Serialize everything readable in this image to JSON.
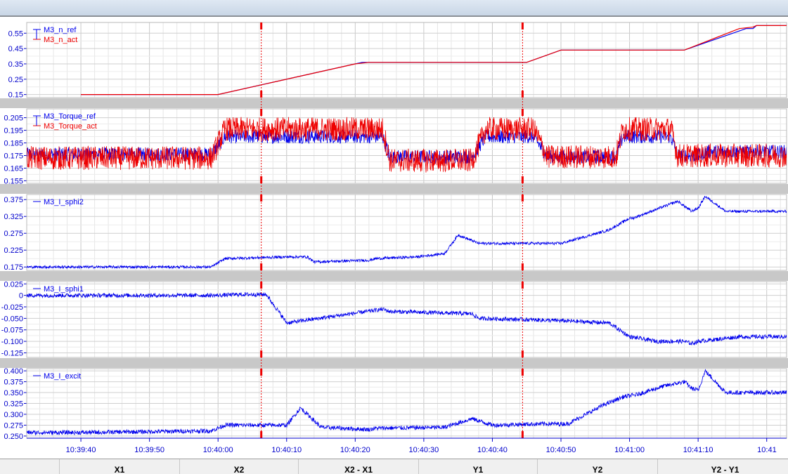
{
  "chart_data": [
    {
      "type": "line",
      "ylim": [
        0.13,
        0.62
      ],
      "yticks": [
        "0.55",
        "0.45",
        "0.35",
        "0.25",
        "0.15"
      ],
      "ytick_values": [
        0.55,
        0.45,
        0.35,
        0.25,
        0.15
      ],
      "series": [
        {
          "name": "M3_n_ref",
          "color": "#0000ee",
          "x": [
            -20,
            0,
            21,
            35,
            45,
            50,
            62,
            68,
            77,
            78,
            78.5,
            130
          ],
          "y": [
            0.15,
            0.15,
            0.36,
            0.36,
            0.36,
            0.44,
            0.44,
            0.44,
            0.58,
            0.58,
            0.6,
            0.6
          ]
        },
        {
          "name": "M3_n_act",
          "color": "#ee0000",
          "x": [
            -20,
            0,
            20,
            22,
            35,
            45,
            50,
            62,
            68,
            76,
            78,
            78.5,
            130
          ],
          "y": [
            0.15,
            0.15,
            0.35,
            0.36,
            0.36,
            0.36,
            0.44,
            0.44,
            0.44,
            0.58,
            0.59,
            0.6,
            0.6
          ]
        }
      ],
      "noise": [
        0,
        0
      ]
    },
    {
      "type": "line",
      "ylim": [
        0.153,
        0.212
      ],
      "yticks": [
        "0.205",
        "0.195",
        "0.185",
        "0.175",
        "0.165",
        "0.155"
      ],
      "ytick_values": [
        0.205,
        0.195,
        0.185,
        0.175,
        0.165,
        0.155
      ],
      "series": [
        {
          "name": "M3_Torque_ref",
          "color": "#0000ee",
          "x": [
            -20,
            -1,
            1,
            9,
            10,
            24,
            25,
            32,
            33,
            37,
            39,
            46,
            48,
            58,
            59,
            66,
            67,
            70,
            71,
            130
          ],
          "y": [
            0.176,
            0.176,
            0.19,
            0.19,
            0.19,
            0.19,
            0.174,
            0.174,
            0.174,
            0.174,
            0.19,
            0.19,
            0.174,
            0.174,
            0.19,
            0.19,
            0.175,
            0.175,
            0.178,
            0.178
          ]
        },
        {
          "name": "M3_Torque_act",
          "color": "#ee0000",
          "x": [
            -20,
            -1,
            1,
            9,
            10,
            24,
            25,
            32,
            33,
            37,
            39,
            46,
            48,
            58,
            59,
            66,
            67,
            70,
            71,
            130
          ],
          "y": [
            0.173,
            0.173,
            0.196,
            0.196,
            0.196,
            0.196,
            0.171,
            0.171,
            0.171,
            0.171,
            0.196,
            0.196,
            0.174,
            0.174,
            0.196,
            0.196,
            0.175,
            0.175,
            0.175,
            0.175
          ]
        }
      ],
      "noise": [
        0.0055,
        0.0095
      ]
    },
    {
      "type": "line",
      "ylim": [
        0.165,
        0.39
      ],
      "yticks": [
        "0.375",
        "0.325",
        "0.275",
        "0.225",
        "0.175"
      ],
      "ytick_values": [
        0.375,
        0.325,
        0.275,
        0.225,
        0.175
      ],
      "series": [
        {
          "name": "M3_I_sphi2",
          "color": "#0000ee",
          "x": [
            -20,
            -1,
            1,
            10,
            13,
            14,
            22,
            23,
            29,
            33,
            35,
            38,
            50,
            57,
            60,
            60.5,
            67,
            69,
            70,
            71,
            74,
            130
          ],
          "y": [
            0.175,
            0.175,
            0.2,
            0.205,
            0.205,
            0.19,
            0.195,
            0.2,
            0.205,
            0.215,
            0.27,
            0.245,
            0.245,
            0.285,
            0.32,
            0.32,
            0.37,
            0.34,
            0.35,
            0.385,
            0.34,
            0.34
          ]
        }
      ],
      "noise": [
        0.004
      ]
    },
    {
      "type": "line",
      "ylim": [
        -0.135,
        0.03
      ],
      "yticks": [
        "0.025",
        "0",
        "-0.025",
        "-0.050",
        "-0.075",
        "-0.100",
        "-0.125"
      ],
      "ytick_values": [
        0.025,
        0,
        -0.025,
        -0.05,
        -0.075,
        -0.1,
        -0.125
      ],
      "series": [
        {
          "name": "M3_I_sphi1",
          "color": "#0000ee",
          "x": [
            -20,
            0,
            3,
            7,
            10,
            24,
            25,
            37,
            38,
            50,
            57,
            60,
            64,
            68,
            69,
            70,
            76,
            130
          ],
          "y": [
            0,
            0,
            0.002,
            0.002,
            -0.06,
            -0.03,
            -0.035,
            -0.04,
            -0.05,
            -0.055,
            -0.06,
            -0.09,
            -0.1,
            -0.1,
            -0.105,
            -0.1,
            -0.09,
            -0.09
          ]
        }
      ],
      "noise": [
        0.0045
      ]
    },
    {
      "type": "line",
      "ylim": [
        0.245,
        0.405
      ],
      "yticks": [
        "0.400",
        "0.375",
        "0.350",
        "0.325",
        "0.300",
        "0.275",
        "0.250"
      ],
      "ytick_values": [
        0.4,
        0.375,
        0.35,
        0.325,
        0.3,
        0.275,
        0.25
      ],
      "series": [
        {
          "name": "M3_I_excit",
          "color": "#0000ee",
          "x": [
            -20,
            -1,
            1,
            10,
            12,
            15,
            22,
            23,
            33,
            37,
            40,
            47,
            51,
            56,
            59,
            61,
            65,
            68,
            69,
            70,
            71,
            74,
            130
          ],
          "y": [
            0.258,
            0.262,
            0.275,
            0.275,
            0.315,
            0.27,
            0.265,
            0.268,
            0.27,
            0.29,
            0.275,
            0.278,
            0.278,
            0.32,
            0.34,
            0.345,
            0.365,
            0.375,
            0.36,
            0.355,
            0.4,
            0.35,
            0.35
          ]
        }
      ],
      "noise": [
        0.005
      ]
    }
  ],
  "x_axis": {
    "tick_labels": [
      "10:39:40",
      "10:39:50",
      "10:40:00",
      "10:40:10",
      "10:40:20",
      "10:40:30",
      "10:40:40",
      "10:40:50",
      "10:41:00",
      "10:41:10",
      "10:41"
    ],
    "tick_values": [
      -20,
      -10,
      0,
      10,
      20,
      30,
      40,
      50,
      60,
      70,
      80
    ],
    "xlim": [
      -27.9,
      82.9
    ]
  },
  "cursors": {
    "x1": 6.3,
    "x2": 44.4,
    "color": "#ee0000"
  },
  "status_bar": {
    "cells": [
      "",
      "X1",
      "X2",
      "X2 - X1",
      "Y1",
      "Y2",
      "Y2 - Y1"
    ]
  },
  "colors": {
    "panel_gap": "#c8c8c8",
    "grid": "#d8d8d8",
    "axis_text": "#0000cc"
  }
}
